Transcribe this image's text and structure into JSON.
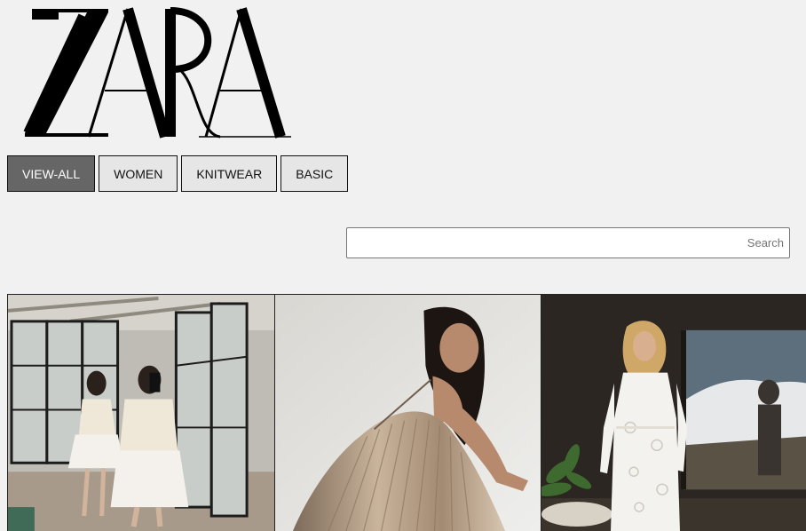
{
  "brand": {
    "logo_text": "ZARA",
    "logo_color": "#000000"
  },
  "filters": [
    {
      "label": "VIEW-ALL",
      "active": true
    },
    {
      "label": "WOMEN",
      "active": false
    },
    {
      "label": "KNITWEAR",
      "active": false
    },
    {
      "label": "BASIC",
      "active": false
    }
  ],
  "search": {
    "placeholder": "Search",
    "value": ""
  },
  "colors": {
    "background": "#f1f1f1",
    "active_button": "#666666",
    "inactive_button": "#e6e6e6"
  }
}
